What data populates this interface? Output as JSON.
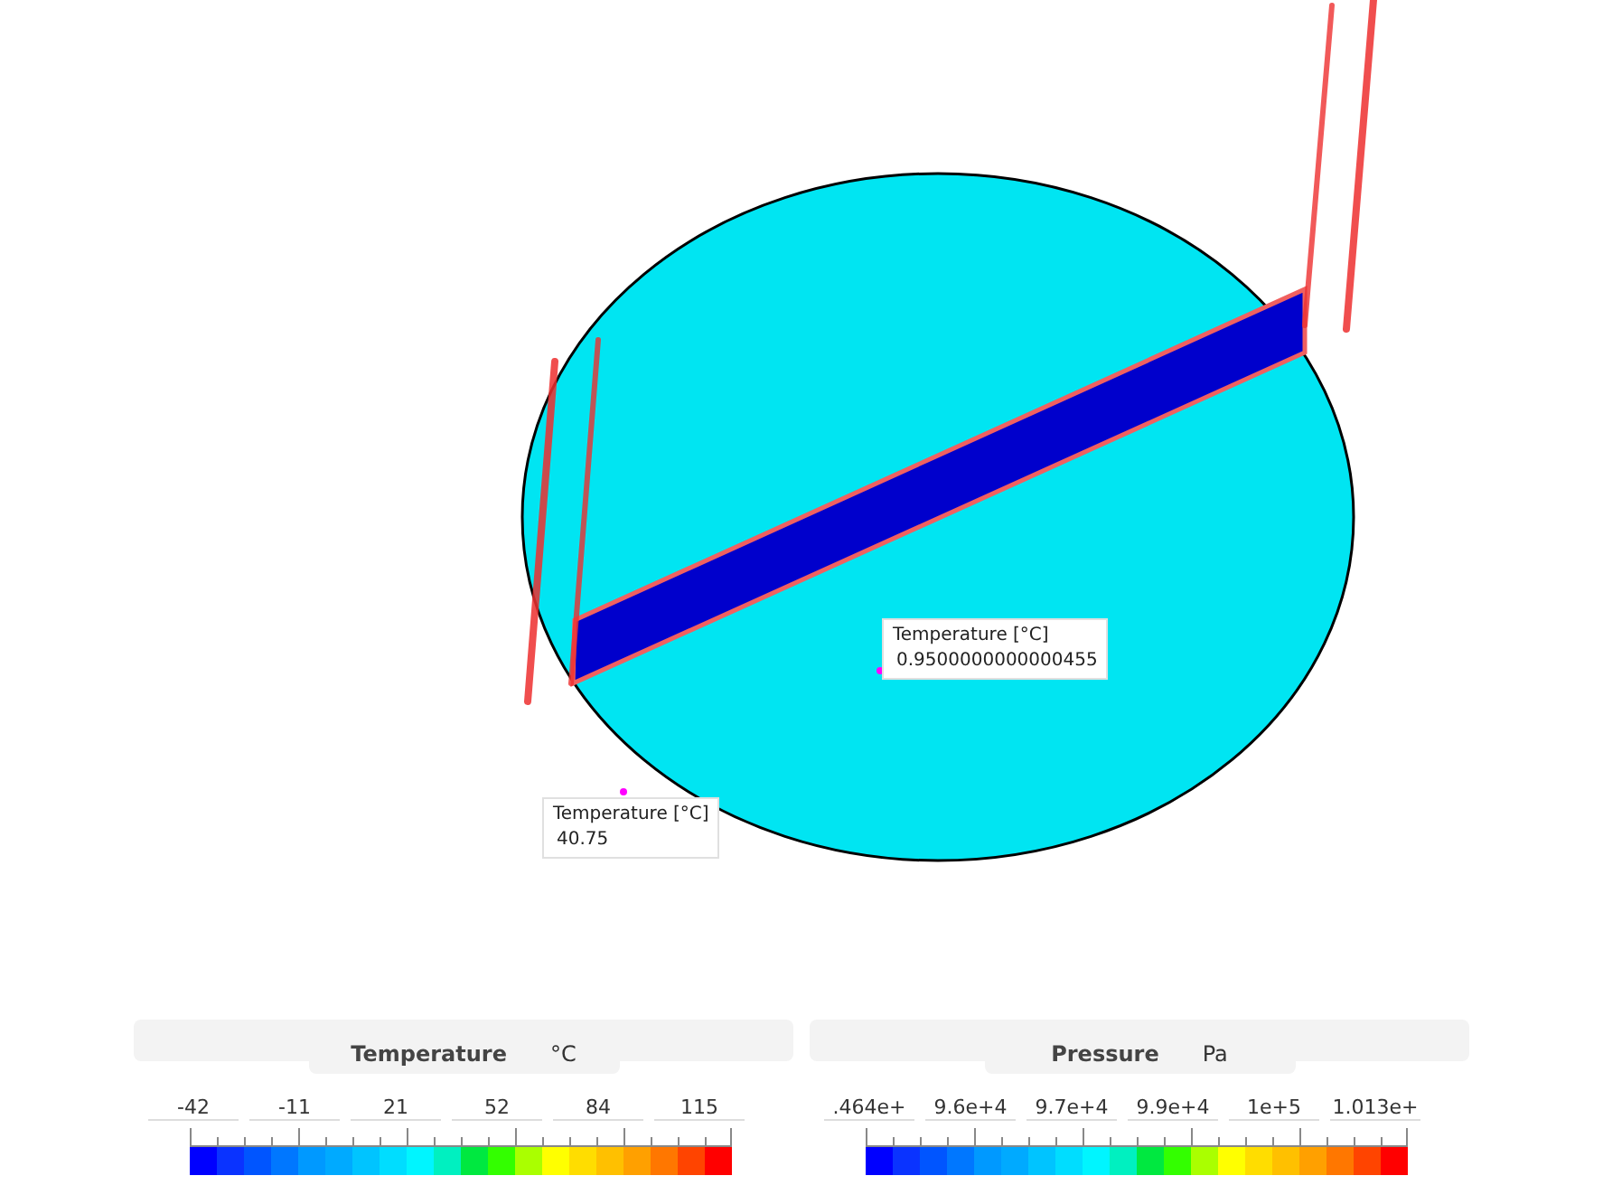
{
  "viewport": {
    "probes": [
      {
        "label": "Temperature [°C]",
        "value": "0.9500000000000455"
      },
      {
        "label": "Temperature [°C]",
        "value": "40.75"
      }
    ]
  },
  "legends": [
    {
      "quantity": "Temperature",
      "unit": "°C",
      "ticks": [
        "-42",
        "-11",
        "21",
        "52",
        "84",
        "115"
      ]
    },
    {
      "quantity": "Pressure",
      "unit": "Pa",
      "ticks": [
        ".464e+",
        "9.6e+4",
        "9.7e+4",
        "9.9e+4",
        "1e+5",
        "1.013e+"
      ]
    }
  ]
}
